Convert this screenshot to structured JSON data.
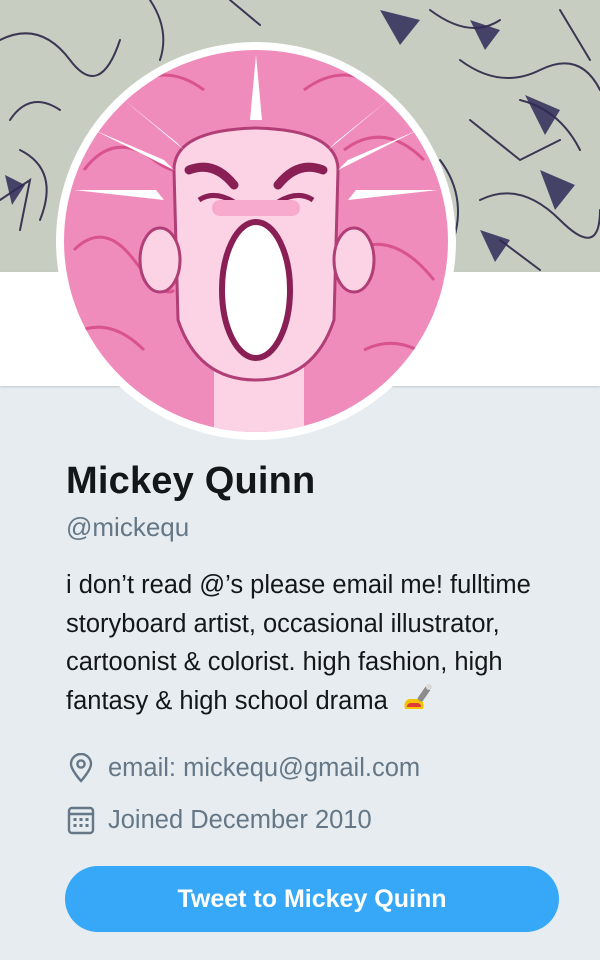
{
  "profile": {
    "display_name": "Mickey Quinn",
    "handle": "@mickequ",
    "bio": "i don’t read @’s please email me! fulltime storyboard artist, occasional illustrator, cartoonist & colorist. high fashion, high fantasy & high school drama",
    "bio_emoji": "nail-polish-icon",
    "location": "email: mickequ@gmail.com",
    "location_icon": "location-pin-icon",
    "joined": "Joined December 2010",
    "joined_icon": "calendar-icon"
  },
  "actions": {
    "tweet_to_label": "Tweet to Mickey Quinn"
  },
  "colors": {
    "accent": "#36a8f7",
    "background": "#e6ecf0",
    "text_primary": "#14171a",
    "text_secondary": "#657786",
    "avatar_pink": "#f49ac4"
  }
}
